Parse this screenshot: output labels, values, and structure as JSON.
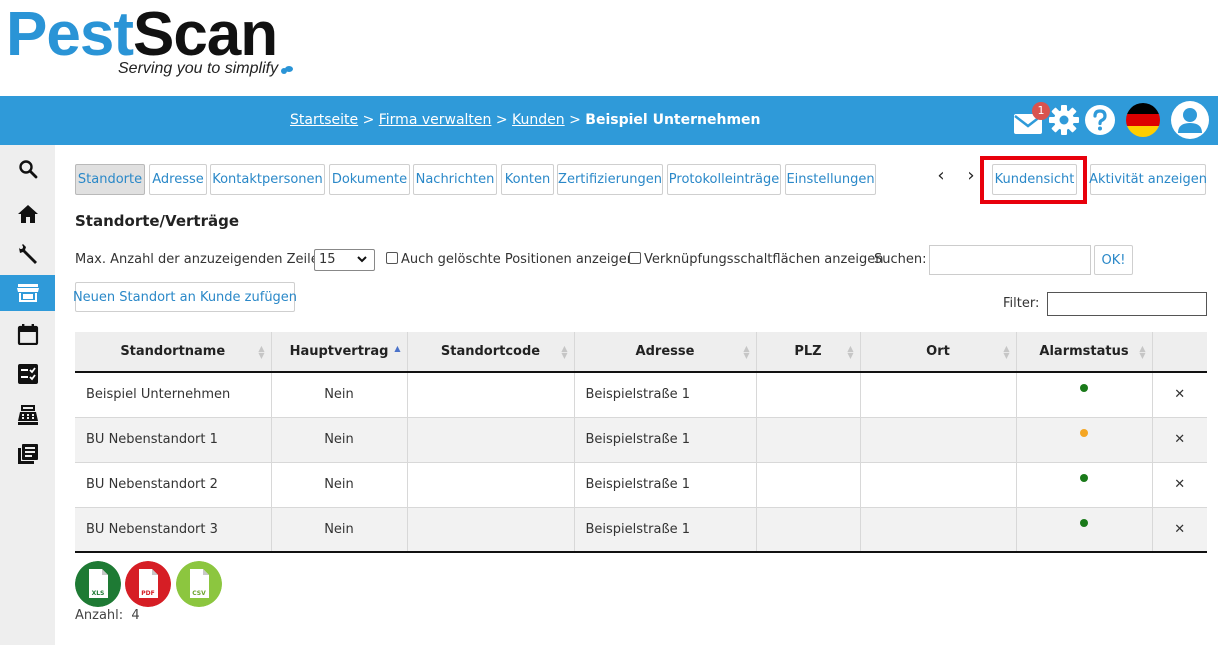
{
  "logo": {
    "word1": "Pest",
    "word2": "Scan",
    "tagline": "Serving you to simplify"
  },
  "header": {
    "breadcrumb": [
      "Startseite",
      "Firma verwalten",
      "Kunden"
    ],
    "separator": ">",
    "current": "Beispiel Unternehmen",
    "mail_badge": "1"
  },
  "sidebar": {
    "items": [
      "search-icon",
      "home-icon",
      "wrench-icon",
      "store-icon",
      "calendar-icon",
      "checklist-icon",
      "cash-register-icon",
      "document-list-icon"
    ],
    "active_index": 3
  },
  "tabs": [
    {
      "label": "Standorte",
      "active": true
    },
    {
      "label": "Adresse"
    },
    {
      "label": "Kontaktpersonen"
    },
    {
      "label": "Dokumente"
    },
    {
      "label": "Nachrichten"
    },
    {
      "label": "Konten"
    },
    {
      "label": "Zertifizierungen"
    },
    {
      "label": "Protokolleinträge"
    },
    {
      "label": "Einstellungen"
    }
  ],
  "nav": {
    "prev": "‹",
    "next": "›"
  },
  "actions": {
    "kundensicht": "Kundensicht",
    "aktivitaet": "Aktivität anzeigen"
  },
  "section_title": "Standorte/Verträge",
  "options": {
    "max_rows_label": "Max. Anzahl der anzuzeigenden Zeilen",
    "max_rows_value": "15",
    "show_deleted": "Auch gelöschte Positionen anzeigen",
    "show_link_buttons": "Verknüpfungsschaltflächen anzeigen",
    "search_label": "Suchen:",
    "ok": "OK!"
  },
  "add_button": "Neuen Standort an Kunde zufügen",
  "filter_label": "Filter:",
  "table": {
    "columns": [
      "Standortname",
      "Hauptvertrag",
      "Standortcode",
      "Adresse",
      "PLZ",
      "Ort",
      "Alarmstatus",
      ""
    ],
    "rows": [
      {
        "name": "Beispiel Unternehmen",
        "hauptvertrag": "Nein",
        "code": "",
        "adresse": "Beispielstraße 1",
        "plz": "",
        "ort": "",
        "alarm": "green",
        "delete": "✕"
      },
      {
        "name": "BU Nebenstandort 1",
        "hauptvertrag": "Nein",
        "code": "",
        "adresse": "Beispielstraße 1",
        "plz": "",
        "ort": "",
        "alarm": "orange",
        "delete": "✕"
      },
      {
        "name": "BU Nebenstandort 2",
        "hauptvertrag": "Nein",
        "code": "",
        "adresse": "Beispielstraße 1",
        "plz": "",
        "ort": "",
        "alarm": "green",
        "delete": "✕"
      },
      {
        "name": "BU Nebenstandort 3",
        "hauptvertrag": "Nein",
        "code": "",
        "adresse": "Beispielstraße 1",
        "plz": "",
        "ort": "",
        "alarm": "green",
        "delete": "✕"
      }
    ]
  },
  "exports": [
    {
      "label": "XLS",
      "color": "#1e7a34"
    },
    {
      "label": "PDF",
      "color": "#d61e25"
    },
    {
      "label": "CSV",
      "color": "#8cc63f"
    }
  ],
  "count": {
    "label": "Anzahl:",
    "value": "4"
  },
  "colors": {
    "accent": "#2f9ad9",
    "link": "#2a88c8",
    "alarm_green": "#1a7a1a",
    "alarm_orange": "#f5a623",
    "highlight": "#e8000c"
  }
}
